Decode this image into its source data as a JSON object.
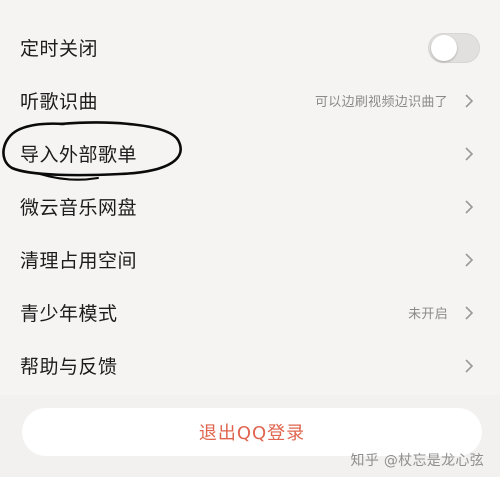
{
  "settings": {
    "items": [
      {
        "label": "定时关闭",
        "control": "toggle",
        "toggle_on": false
      },
      {
        "label": "听歌识曲",
        "hint": "可以边刷视频边识曲了",
        "control": "chevron"
      },
      {
        "label": "导入外部歌单",
        "control": "chevron"
      },
      {
        "label": "微云音乐网盘",
        "control": "chevron"
      },
      {
        "label": "清理占用空间",
        "control": "chevron"
      },
      {
        "label": "青少年模式",
        "hint": "未开启",
        "control": "chevron"
      },
      {
        "label": "帮助与反馈",
        "control": "chevron"
      }
    ]
  },
  "logout": {
    "label": "退出QQ登录",
    "color": "#e0654f"
  },
  "watermark": {
    "text": "知乎 @杖忘是龙心弦"
  },
  "annotation": {
    "type": "hand-drawn-circle",
    "target": "导入外部歌单"
  }
}
